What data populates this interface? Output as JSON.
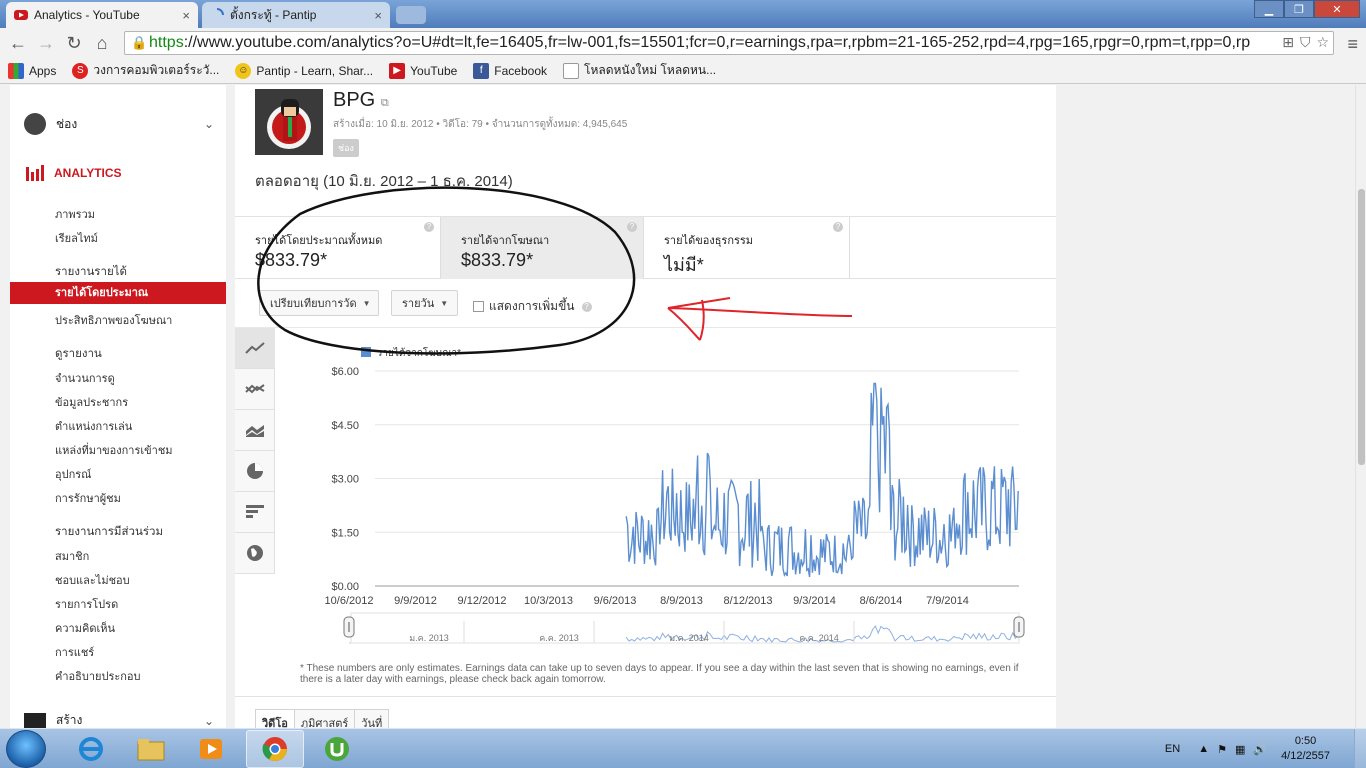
{
  "browser": {
    "tabs": [
      {
        "title": "Analytics - YouTube",
        "active": true
      },
      {
        "title": "ตั้งกระทู้ - Pantip",
        "active": false
      }
    ],
    "url_scheme": "https",
    "url_rest": "://www.youtube.com/analytics?o=U#dt=lt,fe=16405,fr=lw-001,fs=15501;fcr=0,r=earnings,rpa=r,rpbm=21-165-252,rpd=4,rpg=165,rpgr=0,rpm=t,rpp=0,rp",
    "bookmarks": [
      {
        "label": "Apps",
        "icon": "apps-grid-icon"
      },
      {
        "label": "วงการคอมพิวเตอร์ระวั...",
        "icon": "sanook-icon"
      },
      {
        "label": "Pantip - Learn, Shar...",
        "icon": "pantip-icon"
      },
      {
        "label": "YouTube",
        "icon": "youtube-icon"
      },
      {
        "label": "Facebook",
        "icon": "facebook-icon"
      },
      {
        "label": "โหลดหนังใหม่ โหลดหน...",
        "icon": "page-icon"
      }
    ]
  },
  "sidebar": {
    "channel_label": "ช่อง",
    "analytics_label": "ANALYTICS",
    "overview": "ภาพรวม",
    "realtime": "เรียลไทม์",
    "earnings_header": "รายงานรายได้",
    "earnings_items": [
      "รายได้โดยประมาณ",
      "ประสิทธิภาพของโฆษณา"
    ],
    "watch_header": "ดูรายงาน",
    "watch_items": [
      "จำนวนการดู",
      "ข้อมูลประชากร",
      "ตำแหน่งการเล่น",
      "แหล่งที่มาของการเข้าชม",
      "อุปกรณ์",
      "การรักษาผู้ชม"
    ],
    "engagement_header": "รายงานการมีส่วนร่วม",
    "engagement_items": [
      "สมาชิก",
      "ชอบและไม่ชอบ",
      "รายการโปรด",
      "ความคิดเห็น",
      "การแชร์",
      "คำอธิบายประกอบ"
    ],
    "create_label": "สร้าง"
  },
  "channel": {
    "name": "BPG",
    "meta": "สร้างเมื่อ: 10 มิ.ย. 2012  •  วิดีโอ: 79  •  จำนวนการดูทั้งหมด: 4,945,645",
    "badge": "ช่อง",
    "date_range": "ตลอดอายุ (10 มิ.ย. 2012 – 1 ธ.ค. 2014)"
  },
  "metrics": [
    {
      "label": "รายได้โดยประมาณทั้งหมด",
      "value": "$833.79*"
    },
    {
      "label": "รายได้จากโฆษณา",
      "value": "$833.79*"
    },
    {
      "label": "รายได้ของธุรกรรม",
      "value": "ไม่มี*"
    }
  ],
  "controls": {
    "compare_label": "เปรียบเทียบการวัด",
    "granularity_label": "รายวัน",
    "show_growth_label": "แสดงการเพิ่มขึ้น"
  },
  "chart_data": {
    "type": "line",
    "series": [
      {
        "name": "รายได้จากโฆษณา*",
        "color": "#5b8ed0"
      }
    ],
    "y_ticks": [
      "$6.00",
      "$4.50",
      "$3.00",
      "$1.50",
      "$0.00"
    ],
    "ylim": [
      0,
      6
    ],
    "x_ticks": [
      "10/6/2012",
      "9/9/2012",
      "9/12/2012",
      "10/3/2013",
      "9/6/2013",
      "8/9/2013",
      "8/12/2013",
      "9/3/2014",
      "8/6/2014",
      "7/9/2014"
    ],
    "timeline_labels": [
      "ม.ค. 2013",
      "ค.ค. 2013",
      "ม.ค. 2014",
      "ค.ค. 2014"
    ],
    "data_start_fraction": 0.39,
    "segments": [
      {
        "from": 0.39,
        "to": 0.44,
        "low": 0.5,
        "high": 2.2
      },
      {
        "from": 0.44,
        "to": 0.47,
        "low": 0.9,
        "high": 3.3
      },
      {
        "from": 0.47,
        "to": 0.5,
        "low": 0.8,
        "high": 3.0
      },
      {
        "from": 0.5,
        "to": 0.52,
        "low": 0.7,
        "high": 4.5
      },
      {
        "from": 0.52,
        "to": 0.56,
        "low": 0.6,
        "high": 3.0
      },
      {
        "from": 0.56,
        "to": 0.6,
        "low": 0.5,
        "high": 3.0
      },
      {
        "from": 0.6,
        "to": 0.68,
        "low": 0.25,
        "high": 1.8
      },
      {
        "from": 0.68,
        "to": 0.74,
        "low": 0.3,
        "high": 1.5
      },
      {
        "from": 0.74,
        "to": 0.77,
        "low": 0.6,
        "high": 2.5
      },
      {
        "from": 0.77,
        "to": 0.8,
        "low": 1.8,
        "high": 5.6
      },
      {
        "from": 0.8,
        "to": 0.83,
        "low": 0.6,
        "high": 3.0
      },
      {
        "from": 0.83,
        "to": 0.9,
        "low": 0.5,
        "high": 2.3
      },
      {
        "from": 0.9,
        "to": 1.0,
        "low": 0.8,
        "high": 3.4
      }
    ]
  },
  "footnote": "* These numbers are only estimates. Earnings data can take up to seven days to appear. If you see a day within the last seven that is showing no earnings, even if there is a later day with earnings, please check back again tomorrow.",
  "bottom_tabs": [
    "วิดีโอ",
    "ภูมิศาสตร์",
    "วันที่"
  ],
  "taskbar": {
    "language": "EN",
    "time": "0:50",
    "date": "4/12/2557"
  }
}
